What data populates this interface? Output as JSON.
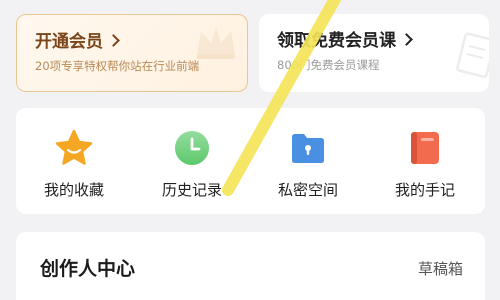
{
  "promo_cards": {
    "vip": {
      "title": "开通会员",
      "subtitle": "20项专享特权帮你站在行业前端"
    },
    "courses": {
      "title": "领取免费会员课",
      "subtitle": "800门免费会员课程"
    }
  },
  "quick_actions": [
    {
      "label": "我的收藏",
      "icon": "star-icon",
      "color": "#f5a623"
    },
    {
      "label": "历史记录",
      "icon": "clock-icon",
      "color": "#5cc96b"
    },
    {
      "label": "私密空间",
      "icon": "folder-lock-icon",
      "color": "#4a90e2"
    },
    {
      "label": "我的手记",
      "icon": "notebook-icon",
      "color": "#f26b4f"
    }
  ],
  "creator_center": {
    "title": "创作人中心",
    "drafts_label": "草稿箱"
  },
  "colors": {
    "page_background": "#f2f2f4",
    "vip_title": "#7a4518",
    "vip_border": "#e9c792",
    "overlay_stroke": "#f5e45a"
  }
}
